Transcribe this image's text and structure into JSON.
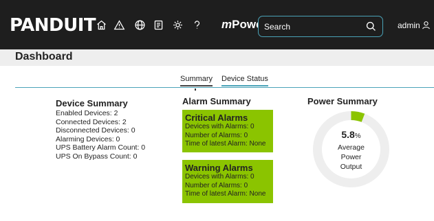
{
  "header": {
    "logo_text": "PANDUIT",
    "brand_prefix": "m",
    "brand_name": "Power",
    "search_placeholder": "Search",
    "user_name": "admin",
    "icons": [
      "home-icon",
      "alert-icon",
      "globe-icon",
      "report-icon",
      "settings-icon",
      "help-icon"
    ]
  },
  "page": {
    "title": "Dashboard"
  },
  "tabs": [
    {
      "label": "Summary",
      "active": true
    },
    {
      "label": "Device Status",
      "active": false
    }
  ],
  "device_summary": {
    "title": "Device Summary",
    "lines": [
      "Enabled Devices: 2",
      "Connected Devices: 2",
      "Disconnected Devices: 0",
      "Alarming Devices: 0",
      "UPS Battery Alarm Count: 0",
      "UPS On Bypass Count: 0"
    ]
  },
  "alarm_summary": {
    "title": "Alarm Summary",
    "critical": {
      "title": "Critical Alarms",
      "lines": [
        "Devices with Alarms: 0",
        "Number of Alarms: 0",
        "Time of latest Alarm: None"
      ]
    },
    "warning": {
      "title": "Warning Alarms",
      "lines": [
        "Devices with Alarms: 0",
        "Number of Alarms: 0",
        "Time of latest Alarm: None"
      ]
    },
    "box_color": "#8bc400"
  },
  "power_summary": {
    "title": "Power Summary",
    "value": "5.8",
    "unit": "%",
    "fraction": 0.058,
    "label_line1": "Average",
    "label_line2": "Power",
    "label_line3": "Output",
    "gauge_fill_color": "#8bc400",
    "gauge_track_color": "#eeeeee"
  },
  "colors": {
    "topbar": "#1e1e1e",
    "accent": "#4aa3b8"
  }
}
